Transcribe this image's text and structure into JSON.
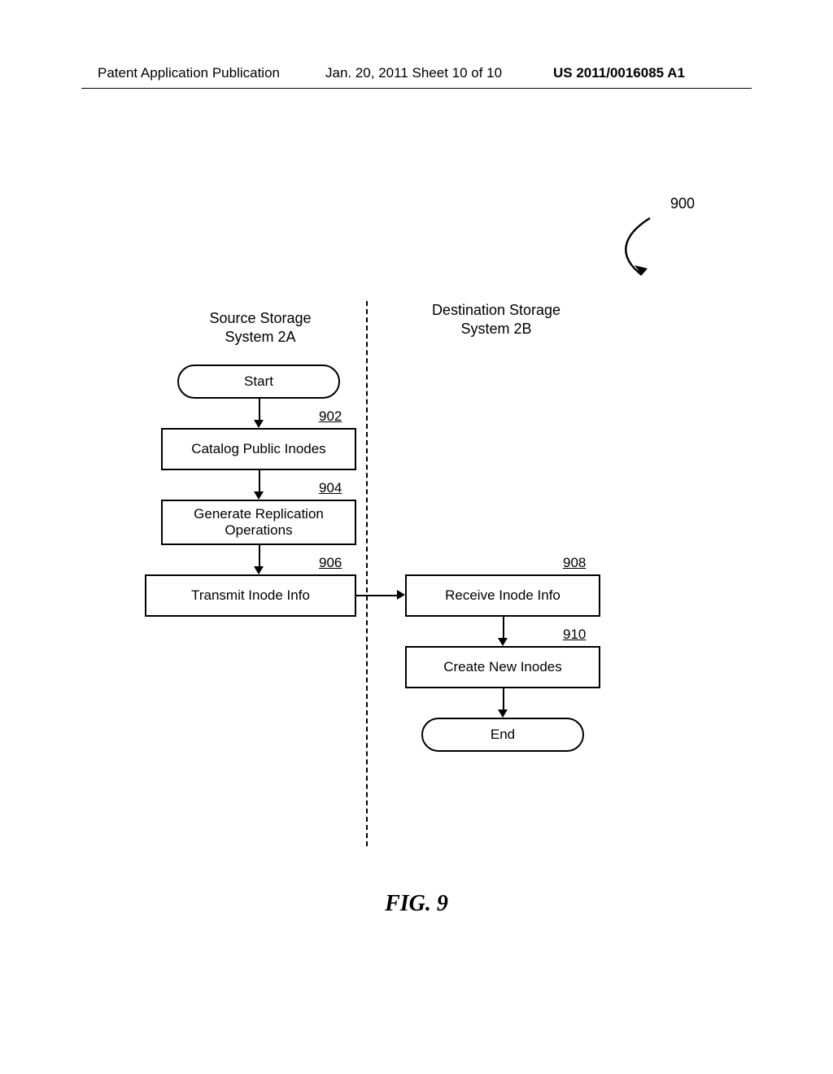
{
  "header": {
    "left": "Patent Application Publication",
    "center": "Jan. 20, 2011  Sheet 10 of 10",
    "right": "US 2011/0016085 A1"
  },
  "ref_label": "900",
  "columns": {
    "source_title_line1": "Source Storage",
    "source_title_line2": "System 2A",
    "dest_title_line1": "Destination Storage",
    "dest_title_line2": "System 2B"
  },
  "nodes": {
    "start": "Start",
    "n902_label": "Catalog Public Inodes",
    "n902_num": "902",
    "n904_label": "Generate Replication Operations",
    "n904_num": "904",
    "n906_label": "Transmit Inode Info",
    "n906_num": "906",
    "n908_label": "Receive Inode Info",
    "n908_num": "908",
    "n910_label": "Create New Inodes",
    "n910_num": "910",
    "end": "End"
  },
  "figure_caption": "FIG. 9"
}
